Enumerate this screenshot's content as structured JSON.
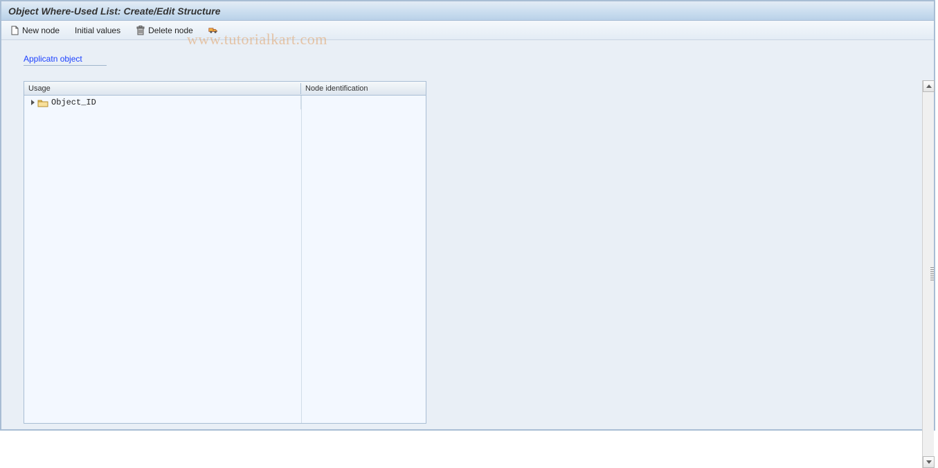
{
  "title": "Object Where-Used List: Create/Edit Structure",
  "toolbar": {
    "new_node": "New node",
    "initial_values": "Initial values",
    "delete_node": "Delete node"
  },
  "link": {
    "application_object": "Applicatn object"
  },
  "tree": {
    "columns": {
      "usage": "Usage",
      "node_id": "Node identification"
    },
    "rows": [
      {
        "label": "Object_ID",
        "node_id": ""
      }
    ]
  },
  "watermark": "www.tutorialkart.com"
}
